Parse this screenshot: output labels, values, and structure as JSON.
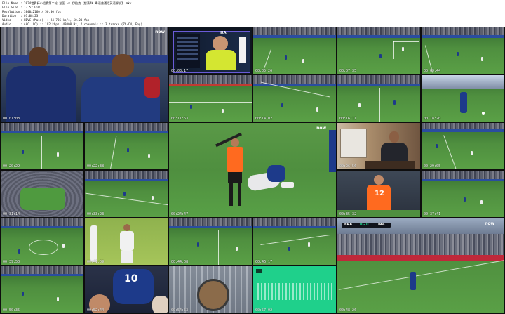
{
  "header": {
    "lines": [
      {
        "key": "File Name",
        "value": "2024世界杯小组赛第二轮 法国 vs 伊拉克【超清4K 粤语普通话英语解说】.mkv"
      },
      {
        "key": "File Size",
        "value": "13.52 GiB"
      },
      {
        "key": "Resolution",
        "value": "3840x2160 / 50.00 fps"
      },
      {
        "key": "Duration",
        "value": "01:08:23"
      },
      {
        "key": "Video",
        "value": "HEVC (Main) :: 24 736 kb/s, 50.00 fps"
      },
      {
        "key": "Audio",
        "value": "AAC (LC) :: 192 kbps, 48000 Hz, 2 channels :: 3 tracks (Zh-CN, Eng)"
      }
    ]
  },
  "broadcaster_logo": "now",
  "scoreboard": {
    "home": "FRA",
    "score": "0 - 0",
    "away": "IRA"
  },
  "timestamps": [
    "00:01:08",
    "00:03:17",
    "00:05:26",
    "00:07:35",
    "00:09:44",
    "00:11:53",
    "00:14:02",
    "00:16:11",
    "00:18:20",
    "00:20:29",
    "00:22:38",
    "00:24:47",
    "00:26:56",
    "00:29:05",
    "00:31:14",
    "00:33:23",
    "00:35:32",
    "00:37:41",
    "00:39:50",
    "00:41:59",
    "00:44:08",
    "00:46:17",
    "00:48:26",
    "00:50:35",
    "00:52:44",
    "00:54:53",
    "00:57:02",
    "00:59:11",
    "01:01:20",
    "01:03:29"
  ],
  "goalkeeper_number": "12",
  "colors": {
    "pitch": "#4f8f3f",
    "france_blue": "#1d3a8a",
    "ref_orange": "#ff6a1f",
    "accent_green": "#1fd08b"
  }
}
